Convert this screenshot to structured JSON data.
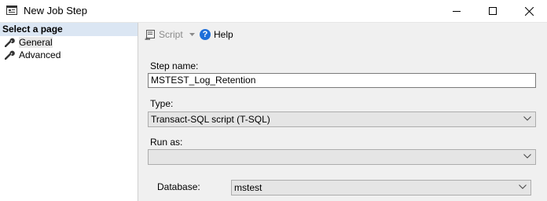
{
  "window": {
    "title": "New Job Step",
    "icon": "job-step-window-icon",
    "controls": [
      "minimize-icon",
      "maximize-icon",
      "close-icon"
    ]
  },
  "sidebar": {
    "header": "Select a page",
    "items": [
      {
        "label": "General",
        "icon": "wrench-icon",
        "selected": true
      },
      {
        "label": "Advanced",
        "icon": "wrench-icon",
        "selected": false
      }
    ]
  },
  "toolbar": {
    "script_label": "Script",
    "script_icon": "script-icon",
    "help_label": "Help",
    "help_icon": "help-icon"
  },
  "form": {
    "step_name_label": "Step name:",
    "step_name_value": "MSTEST_Log_Retention",
    "type_label": "Type:",
    "type_value": "Transact-SQL script (T-SQL)",
    "run_as_label": "Run as:",
    "run_as_value": "",
    "database_label": "Database:",
    "database_value": "mstest"
  },
  "colors": {
    "header_bg": "#dbe6f3",
    "panel_bg": "#f0f0f0",
    "help_blue": "#1e6fd9"
  }
}
